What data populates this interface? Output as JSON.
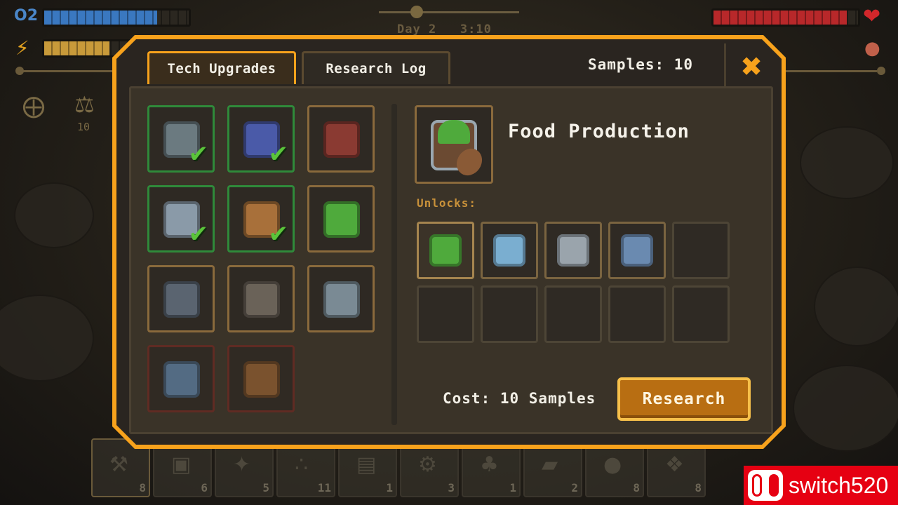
{
  "hud": {
    "oxygen_label": "O2",
    "oxygen_level": 0.78,
    "energy_level": 0.45,
    "health_level": 0.92,
    "day": "Day 2",
    "time": "3:10",
    "samples_count": "10"
  },
  "modal": {
    "tabs": [
      "Tech Upgrades",
      "Research Log"
    ],
    "samples_label": "Samples: 10"
  },
  "tech_items": [
    {
      "icon": "storage-crate-icon",
      "state": "researched",
      "color": "#6b7a80"
    },
    {
      "icon": "solar-panel-icon",
      "state": "researched",
      "color": "#4a5aa8"
    },
    {
      "icon": "turret-icon",
      "state": "available",
      "color": "#8a3a32"
    },
    {
      "icon": "small-container-icon",
      "state": "researched",
      "color": "#8a9aa8"
    },
    {
      "icon": "meal-icon",
      "state": "researched",
      "color": "#a8703a"
    },
    {
      "icon": "food-production-icon",
      "state": "available",
      "color": "#4faa3c"
    },
    {
      "icon": "signal-tower-icon",
      "state": "available",
      "color": "#5a6470"
    },
    {
      "icon": "rover-icon",
      "state": "available",
      "color": "#6a6258"
    },
    {
      "icon": "recycler-icon",
      "state": "available",
      "color": "#7a8a94"
    },
    {
      "icon": "drone-icon",
      "state": "locked",
      "color": "#5a7a9a"
    },
    {
      "icon": "helmet-icon",
      "state": "locked",
      "color": "#8a5a30"
    }
  ],
  "detail": {
    "title": "Food Production",
    "unlocks_label": "Unlocks:",
    "unlocks": [
      {
        "icon": "planter-icon",
        "color": "#4faa3c"
      },
      {
        "icon": "water-tank-icon",
        "color": "#7aaed0"
      },
      {
        "icon": "stove-icon",
        "color": "#9aa4ac"
      },
      {
        "icon": "kitchen-robot-icon",
        "color": "#6a8ab0"
      },
      null,
      null,
      null,
      null,
      null,
      null
    ],
    "cost": "Cost: 10 Samples",
    "button": "Research"
  },
  "hotbar": [
    {
      "icon": "shovel-icon",
      "count": "8",
      "glyph": "⚒"
    },
    {
      "icon": "metal-plate-icon",
      "count": "6",
      "glyph": "▣"
    },
    {
      "icon": "rock-pile-icon",
      "count": "5",
      "glyph": "✦"
    },
    {
      "icon": "gravel-icon",
      "count": "11",
      "glyph": "∴"
    },
    {
      "icon": "circuit-board-icon",
      "count": "1",
      "glyph": "▤"
    },
    {
      "icon": "gear-icon",
      "count": "3",
      "glyph": "⚙"
    },
    {
      "icon": "plant-fiber-icon",
      "count": "1",
      "glyph": "♣"
    },
    {
      "icon": "metal-bar-icon",
      "count": "2",
      "glyph": "▰"
    },
    {
      "icon": "stone-icon",
      "count": "8",
      "glyph": "●"
    },
    {
      "icon": "crystal-icon",
      "count": "8",
      "glyph": "❖"
    }
  ],
  "watermark": "switch520"
}
